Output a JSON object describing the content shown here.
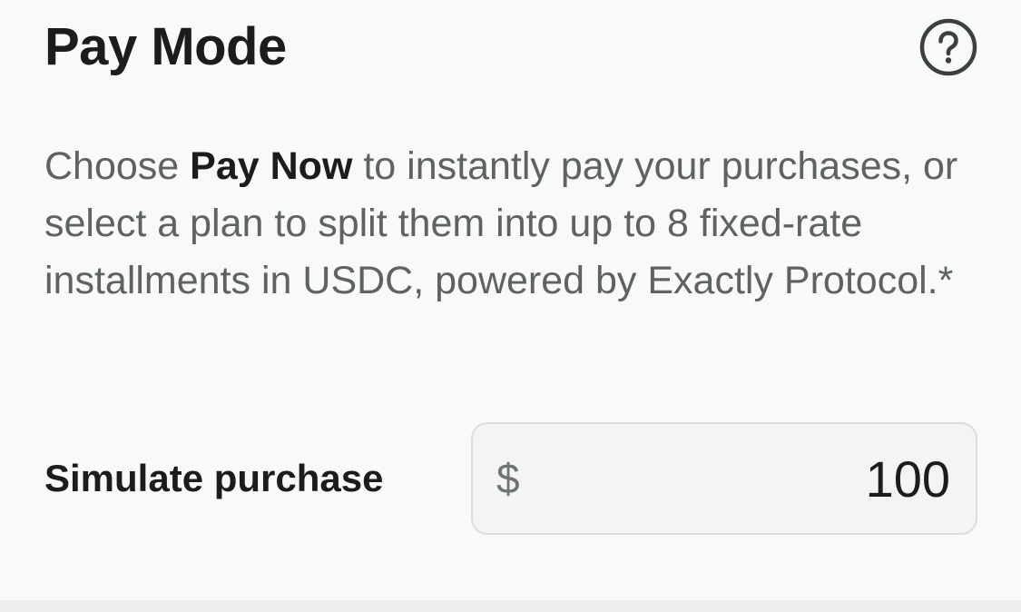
{
  "header": {
    "title": "Pay Mode",
    "help_icon": "question-circle-icon"
  },
  "description": {
    "prefix": "Choose ",
    "highlight": "Pay Now",
    "suffix": " to instantly pay your purchases, or select a plan to split them into up to 8 fixed-rate installments in USDC, powered by Exactly Protocol.*"
  },
  "simulate": {
    "label": "Simulate purchase",
    "currency_symbol": "$",
    "amount": "100"
  },
  "colors": {
    "background": "#f8f9f8",
    "text_primary": "#1a1d1c",
    "text_secondary": "#5e6361",
    "input_border": "#dcdedd"
  }
}
